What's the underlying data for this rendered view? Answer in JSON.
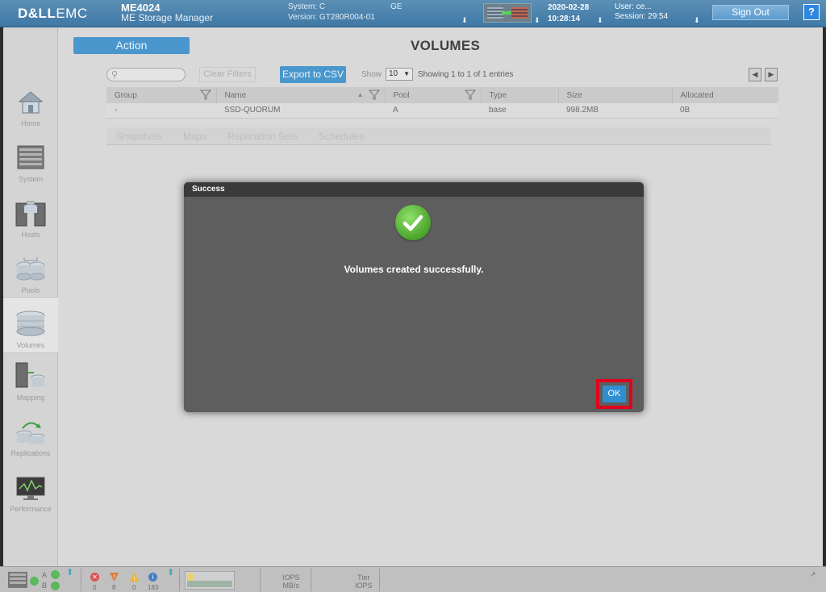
{
  "header": {
    "logo_bold": "D&LL",
    "logo_light": "EMC",
    "model": "ME4024",
    "product_name": "ME Storage Manager",
    "system_label": "System: C",
    "system_suffix": "GE",
    "version": "Version: GT280R004-01",
    "date": "2020-02-28",
    "time": "10:28:14",
    "user": "User: ce...",
    "session": "Session: 29:54",
    "sign_out": "Sign Out",
    "help": "?"
  },
  "sidebar": {
    "items": [
      {
        "label": "Home",
        "icon": "home-icon"
      },
      {
        "label": "System",
        "icon": "system-icon"
      },
      {
        "label": "Hosts",
        "icon": "hosts-icon"
      },
      {
        "label": "Pools",
        "icon": "pools-icon"
      },
      {
        "label": "Volumes",
        "icon": "volumes-icon"
      },
      {
        "label": "Mapping",
        "icon": "mapping-icon"
      },
      {
        "label": "Replications",
        "icon": "replications-icon"
      },
      {
        "label": "Performance",
        "icon": "performance-icon"
      }
    ]
  },
  "main": {
    "action": "Action",
    "title": "VOLUMES",
    "clear_filters": "Clear Filters",
    "export_csv": "Export to CSV",
    "show_label": "Show",
    "page_size": "10",
    "showing": "Showing 1 to 1 of 1 entries",
    "columns": [
      "Group",
      "Name",
      "Pool",
      "Type",
      "Size",
      "Allocated"
    ],
    "rows": [
      [
        "-",
        "SSD-QUORUM",
        "A",
        "base",
        "998.2MB",
        "0B"
      ]
    ],
    "tabs": [
      "Snapshots",
      "Maps",
      "Replication Sets",
      "Schedules"
    ]
  },
  "modal": {
    "title": "Success",
    "message": "Volumes created successfully.",
    "ok": "OK"
  },
  "statusbar": {
    "ctrl_a": "A",
    "ctrl_b": "B",
    "count_error": "0",
    "count_critical": "8",
    "count_warning": "0",
    "count_info": "183",
    "iops": "IOPS",
    "mbs": "MB/s",
    "tier": "Tier",
    "tier_iops": "IOPS"
  }
}
